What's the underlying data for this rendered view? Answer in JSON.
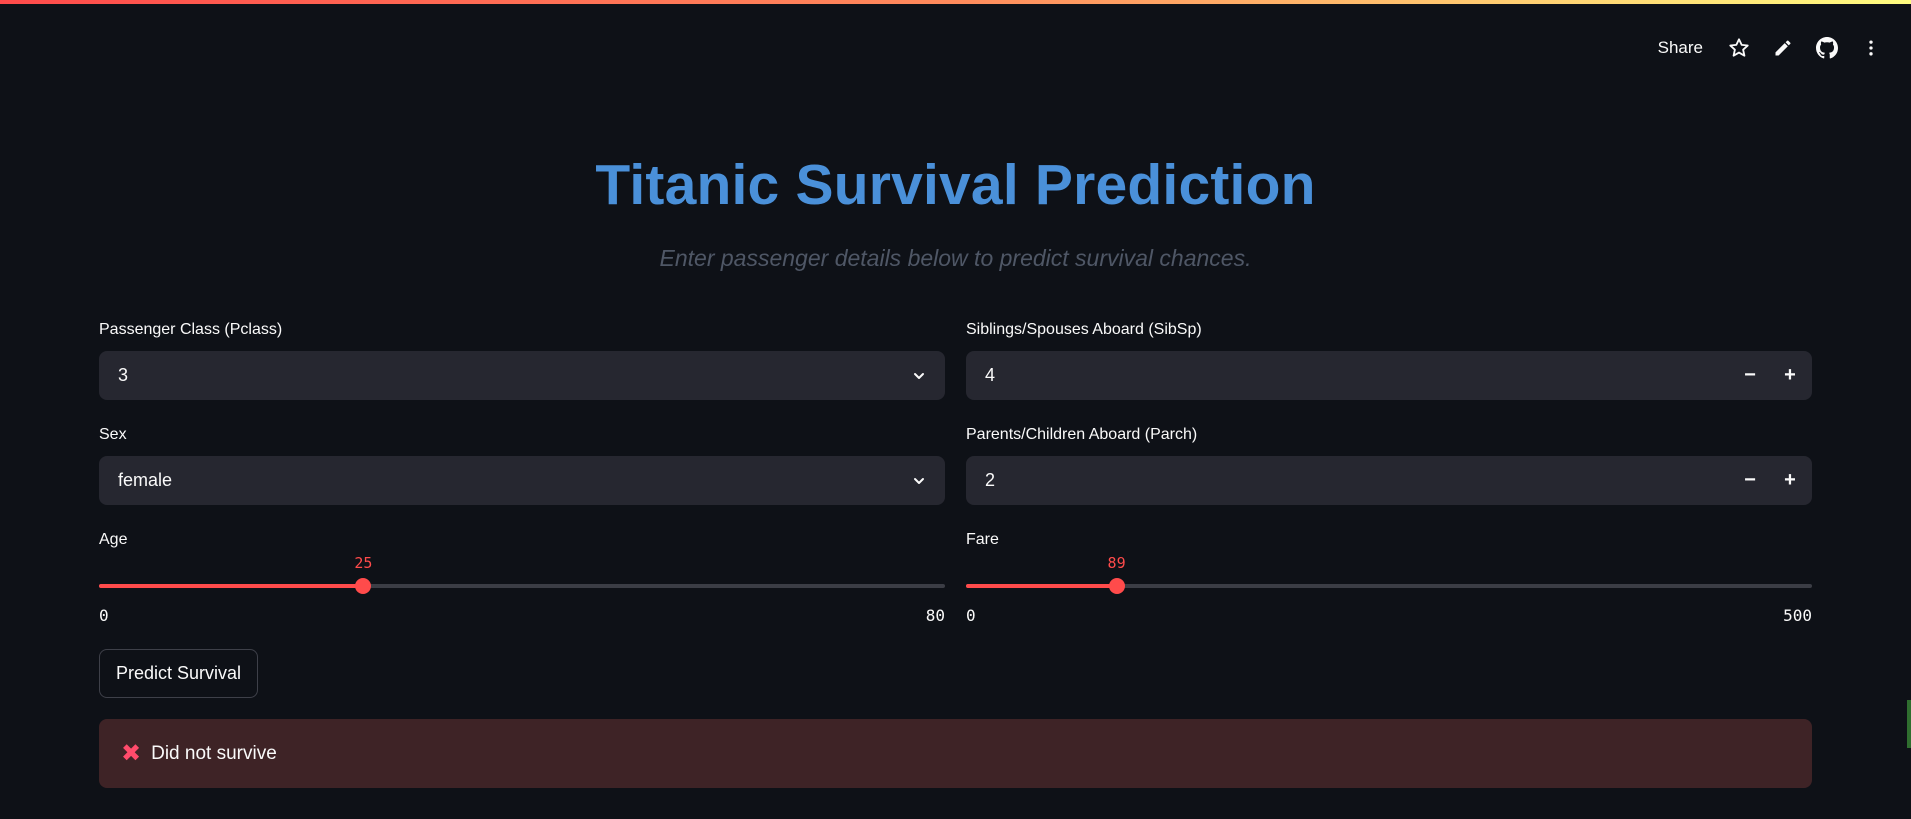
{
  "toolbar": {
    "share_label": "Share",
    "icons": [
      "star-icon",
      "pencil-icon",
      "github-icon",
      "more-vertical-icon"
    ]
  },
  "header": {
    "title": "Titanic Survival Prediction",
    "subtitle": "Enter passenger details below to predict survival chances."
  },
  "form": {
    "pclass": {
      "label": "Passenger Class (Pclass)",
      "value": "3"
    },
    "sex": {
      "label": "Sex",
      "value": "female"
    },
    "sibsp": {
      "label": "Siblings/Spouses Aboard (SibSp)",
      "value": "4",
      "minus": "−",
      "plus": "+"
    },
    "parch": {
      "label": "Parents/Children Aboard (Parch)",
      "value": "2",
      "minus": "−",
      "plus": "+"
    },
    "age": {
      "label": "Age",
      "value": 25,
      "min": 0,
      "max": 80
    },
    "fare": {
      "label": "Fare",
      "value": 89,
      "min": 0,
      "max": 500
    }
  },
  "predict_button": {
    "label": "Predict Survival"
  },
  "result": {
    "icon": "✖",
    "message": "Did not survive"
  },
  "colors": {
    "background": "#0e1117",
    "accent": "#ff4b4b",
    "title": "#4a90d9",
    "input_bg": "#262730",
    "error_bg": "#3e2326"
  }
}
